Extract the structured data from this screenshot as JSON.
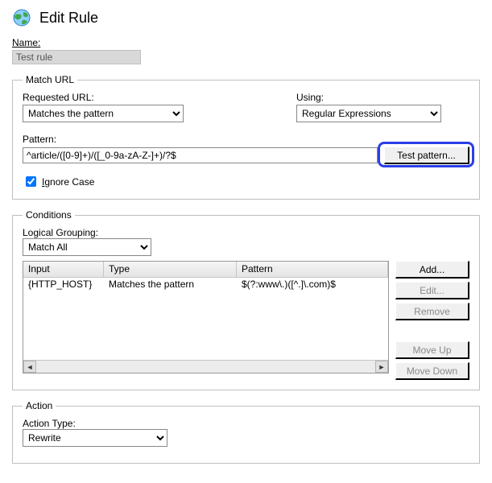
{
  "header": {
    "title": "Edit Rule"
  },
  "name": {
    "label": "Name:",
    "value": "Test rule"
  },
  "match_url": {
    "legend": "Match URL",
    "requested_label": "Requested URL:",
    "requested_value": "Matches the pattern",
    "using_label": "Using:",
    "using_value": "Regular Expressions",
    "pattern_label": "Pattern:",
    "pattern_value": "^article/([0-9]+)/([_0-9a-zA-Z-]+)/?$",
    "test_button": "Test pattern...",
    "ignore_case_checked": true,
    "ignore_case_prefix": "I",
    "ignore_case_rest": "gnore Case"
  },
  "conditions": {
    "legend": "Conditions",
    "grouping_label": "Logical Grouping:",
    "grouping_value": "Match All",
    "columns": {
      "input": "Input",
      "type": "Type",
      "pattern": "Pattern"
    },
    "rows": [
      {
        "input": "{HTTP_HOST}",
        "type": "Matches the pattern",
        "pattern": "$(?:www\\.)([^.]\\.com)$"
      }
    ],
    "buttons": {
      "add": "Add...",
      "edit": "Edit...",
      "remove": "Remove",
      "move_up": "Move Up",
      "move_down": "Move Down"
    }
  },
  "action": {
    "legend": "Action",
    "type_label": "Action Type:",
    "type_value": "Rewrite"
  }
}
